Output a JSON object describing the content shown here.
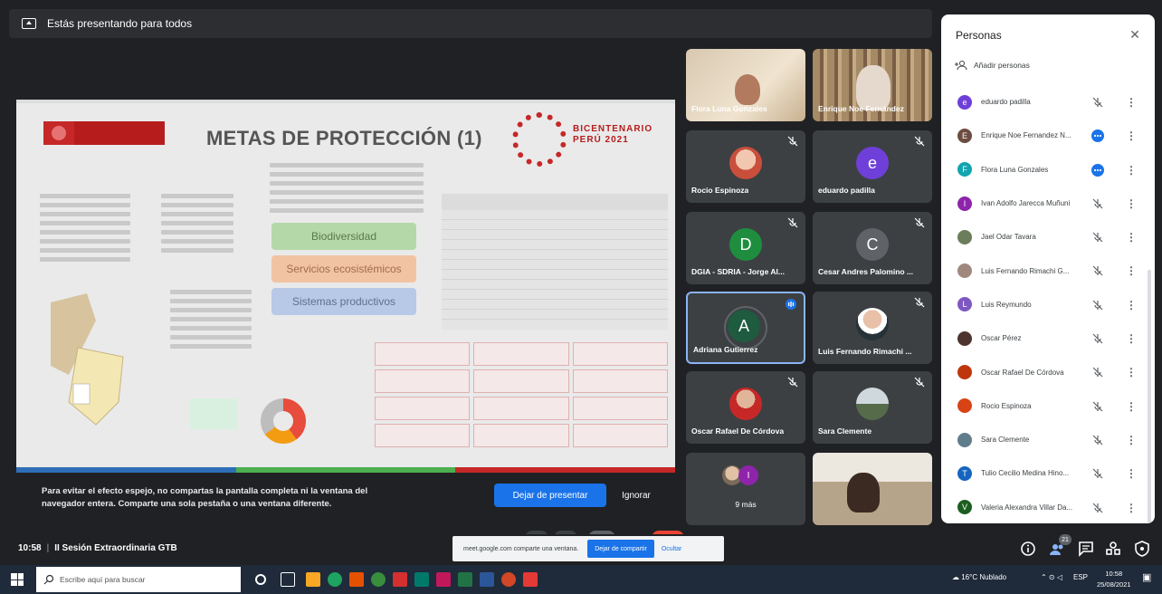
{
  "presenting_bar": {
    "label": "Estás presentando para todos"
  },
  "slide": {
    "title": "METAS DE PROTECCIÓN (1)",
    "brand_line1": "BICENTENARIO",
    "brand_line2": "PERÚ 2021",
    "pills": [
      "Biodiversidad",
      "Servicios ecosistémicos",
      "Sistemas productivos"
    ]
  },
  "mirror_warning": {
    "message": "Para evitar el efecto espejo, no compartas la pantalla completa ni la ventana del navegador entera. Comparte una sola pestaña o una ventana diferente.",
    "stop_label": "Dejar de presentar",
    "ignore_label": "Ignorar"
  },
  "tiles": [
    {
      "name": "Flora Luna Gonzales",
      "kind": "video"
    },
    {
      "name": "Enrique Noe Fernández",
      "kind": "video"
    },
    {
      "name": "Rocio Espinoza",
      "kind": "photo"
    },
    {
      "name": "eduardo padilla",
      "kind": "letter",
      "letter": "e",
      "color": "#6f3fd9"
    },
    {
      "name": "DGIA - SDRIA - Jorge Al...",
      "kind": "letter",
      "letter": "D",
      "color": "#1e8e3e"
    },
    {
      "name": "Cesar Andres Palomino ...",
      "kind": "letter",
      "letter": "C",
      "color": "#5f6368"
    },
    {
      "name": "Adriana Gutierrez",
      "kind": "letter",
      "letter": "A",
      "color": "#1e5b3f"
    },
    {
      "name": "Luis Fernando Rimachi ...",
      "kind": "photo"
    },
    {
      "name": "Oscar Rafael De Córdova",
      "kind": "photo"
    },
    {
      "name": "Sara Clemente",
      "kind": "photo"
    },
    {
      "name": "9 más",
      "kind": "more"
    },
    {
      "name": "",
      "kind": "video"
    }
  ],
  "people_panel": {
    "title": "Personas",
    "add_label": "Añadir personas",
    "participants": [
      {
        "name": "eduardo padilla",
        "letter": "e",
        "color": "#6f3fd9",
        "status": "muted"
      },
      {
        "name": "Enrique Noe Fernandez N...",
        "letter": "E",
        "color": "#6d4c41",
        "status": "speaking"
      },
      {
        "name": "Flora Luna Gonzales",
        "letter": "F",
        "color": "#12a4af",
        "status": "speaking"
      },
      {
        "name": "Ivan Adolfo Jarecca Muñuni",
        "letter": "I",
        "color": "#8e24aa",
        "status": "muted"
      },
      {
        "name": "Jael Odar Tavara",
        "letter": "",
        "color": "#6b7d5a",
        "status": "muted"
      },
      {
        "name": "Luis Fernando Rimachi G...",
        "letter": "",
        "color": "#a1887f",
        "status": "muted"
      },
      {
        "name": "Luis Reymundo",
        "letter": "L",
        "color": "#7e57c2",
        "status": "muted"
      },
      {
        "name": "Oscar Pérez",
        "letter": "",
        "color": "#4e342e",
        "status": "muted"
      },
      {
        "name": "Oscar Rafael De Córdova",
        "letter": "",
        "color": "#bf360c",
        "status": "muted"
      },
      {
        "name": "Rocio Espinoza",
        "letter": "",
        "color": "#d84315",
        "status": "muted"
      },
      {
        "name": "Sara Clemente",
        "letter": "",
        "color": "#607d8b",
        "status": "muted"
      },
      {
        "name": "Tulio Cecilio Medina Hino...",
        "letter": "T",
        "color": "#1565c0",
        "status": "muted"
      },
      {
        "name": "Valeria Alexandra Villar Da...",
        "letter": "V",
        "color": "#1b5e20",
        "status": "muted"
      }
    ]
  },
  "bottom_bar": {
    "time": "10:58",
    "meeting_title": "II Sesión Extraordinaria GTB",
    "participant_count": "21",
    "share_popup": {
      "text": "meet.google.com comparte una ventana.",
      "stop_label": "Dejar de compartir",
      "hide_label": "Ocultar"
    }
  },
  "taskbar": {
    "search_placeholder": "Escribe aquí para buscar",
    "weather": "16°C Nublado",
    "language": "ESP",
    "clock_time": "10:58",
    "clock_date": "25/08/2021"
  },
  "colors": {
    "accent": "#1a73e8",
    "meet_bg": "#202124",
    "tile_bg": "#3c4043",
    "speaking_blue": "#1a73e8"
  }
}
